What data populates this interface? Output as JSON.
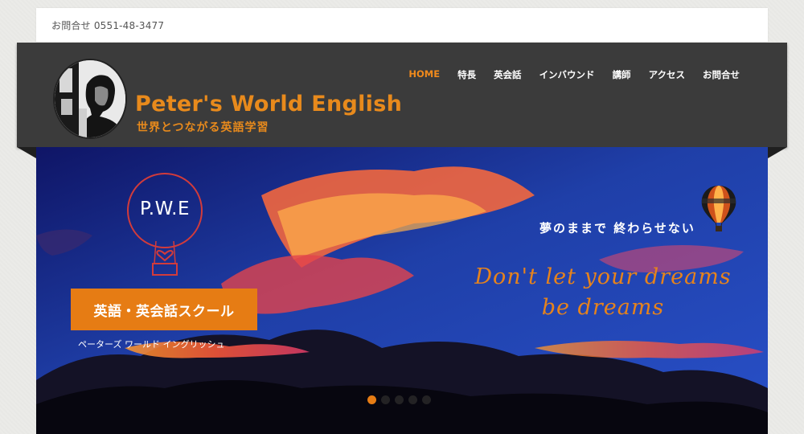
{
  "topbar": {
    "contact": "お問合せ 0551-48-3477"
  },
  "brand": {
    "title": "Peter's World English",
    "subtitle": "世界とつながる英語学習"
  },
  "nav": {
    "items": [
      {
        "label": "HOME",
        "active": true
      },
      {
        "label": "特長"
      },
      {
        "label": "英会話"
      },
      {
        "label": "インバウンド"
      },
      {
        "label": "講師"
      },
      {
        "label": "アクセス"
      },
      {
        "label": "お問合せ"
      }
    ]
  },
  "hero": {
    "pwe": "P.W.E",
    "school_label": "英語・英会話スクール",
    "katakana": "ペーターズ ワールド イングリッシュ",
    "jp_slogan": "夢のままで 終わらせない",
    "en_slogan_line1": "Don't let your dreams",
    "en_slogan_line2": "be dreams",
    "slides": 5,
    "active_slide": 1
  },
  "colors": {
    "accent": "#e67c14",
    "header_bg": "#3b3b3b",
    "ring": "#d23b3b"
  }
}
